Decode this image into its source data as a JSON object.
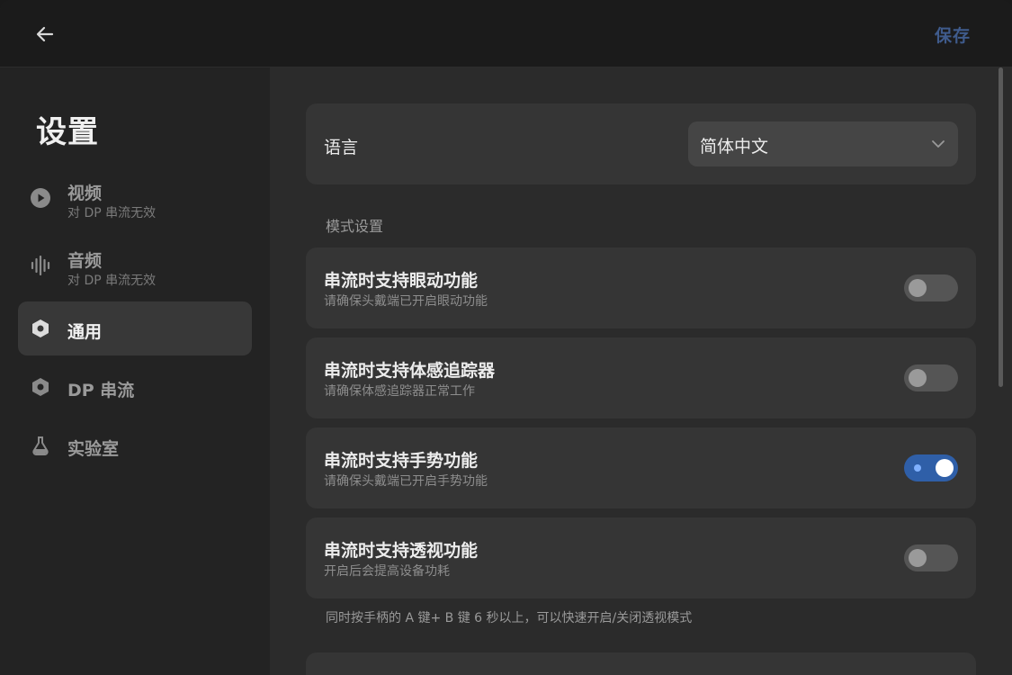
{
  "header": {
    "back_icon": "arrow-left-icon",
    "save_label": "保存",
    "save_color": "#3f5b8c"
  },
  "sidebar": {
    "title": "设置",
    "items": [
      {
        "label": "视频",
        "sub": "对 DP 串流无效",
        "icon": "play-icon",
        "active": false
      },
      {
        "label": "音频",
        "sub": "对 DP 串流无效",
        "icon": "audio-wave-icon",
        "active": false
      },
      {
        "label": "通用",
        "sub": "",
        "icon": "hex-nut-icon",
        "active": true
      },
      {
        "label": "DP 串流",
        "sub": "",
        "icon": "hex-nut-icon",
        "active": false
      },
      {
        "label": "实验室",
        "sub": "",
        "icon": "flask-icon",
        "active": false
      }
    ]
  },
  "main": {
    "language": {
      "label": "语言",
      "selected": "简体中文"
    },
    "section_title": "模式设置",
    "settings": [
      {
        "title": "串流时支持眼动功能",
        "desc": "请确保头戴端已开启眼动功能",
        "on": false
      },
      {
        "title": "串流时支持体感追踪器",
        "desc": "请确保体感追踪器正常工作",
        "on": false
      },
      {
        "title": "串流时支持手势功能",
        "desc": "请确保头戴端已开启手势功能",
        "on": true
      },
      {
        "title": "串流时支持透视功能",
        "desc": "开启后会提高设备功耗",
        "on": false
      }
    ],
    "footnote": "同时按手柄的 A 键+ B 键 6 秒以上，可以快速开启/关闭透视模式"
  },
  "colors": {
    "accent": "#2f5fa8",
    "background": "#2b2b2b",
    "card": "#353535"
  }
}
